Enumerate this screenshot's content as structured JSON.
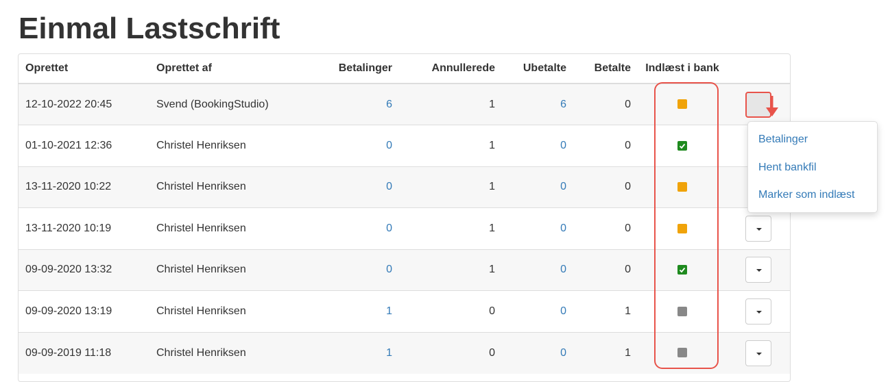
{
  "page": {
    "title": "Einmal Lastschrift"
  },
  "table": {
    "headers": [
      "Oprettet",
      "Oprettet af",
      "Betalinger",
      "Annullerede",
      "Ubetalte",
      "Betalte",
      "Indlæst i bank"
    ],
    "rows": [
      {
        "created": "12-10-2022 20:45",
        "created_by": "Svend (BookingStudio)",
        "payments": "6",
        "cancelled": "1",
        "unpaid": "6",
        "paid": "0",
        "status": "pending"
      },
      {
        "created": "01-10-2021 12:36",
        "created_by": "Christel Henriksen",
        "payments": "0",
        "cancelled": "1",
        "unpaid": "0",
        "paid": "0",
        "status": "loaded"
      },
      {
        "created": "13-11-2020 10:22",
        "created_by": "Christel Henriksen",
        "payments": "0",
        "cancelled": "1",
        "unpaid": "0",
        "paid": "0",
        "status": "pending"
      },
      {
        "created": "13-11-2020 10:19",
        "created_by": "Christel Henriksen",
        "payments": "0",
        "cancelled": "1",
        "unpaid": "0",
        "paid": "0",
        "status": "pending"
      },
      {
        "created": "09-09-2020 13:32",
        "created_by": "Christel Henriksen",
        "payments": "0",
        "cancelled": "1",
        "unpaid": "0",
        "paid": "0",
        "status": "loaded"
      },
      {
        "created": "09-09-2020 13:19",
        "created_by": "Christel Henriksen",
        "payments": "1",
        "cancelled": "0",
        "unpaid": "0",
        "paid": "1",
        "status": "inactive"
      },
      {
        "created": "09-09-2019 11:18",
        "created_by": "Christel Henriksen",
        "payments": "1",
        "cancelled": "0",
        "unpaid": "0",
        "paid": "1",
        "status": "inactive"
      }
    ]
  },
  "dropdown_menu": {
    "items": [
      "Betalinger",
      "Hent bankfil",
      "Marker som indlæst"
    ]
  },
  "status_colors": {
    "pending": "#f0a30a",
    "loaded": "#1e8a1e",
    "inactive": "#888888"
  },
  "annotation_color": "#e8534a",
  "icons": {
    "row_action": "caret-down-icon",
    "loaded": "checkmark-icon",
    "annotation": "arrow-down-icon"
  }
}
